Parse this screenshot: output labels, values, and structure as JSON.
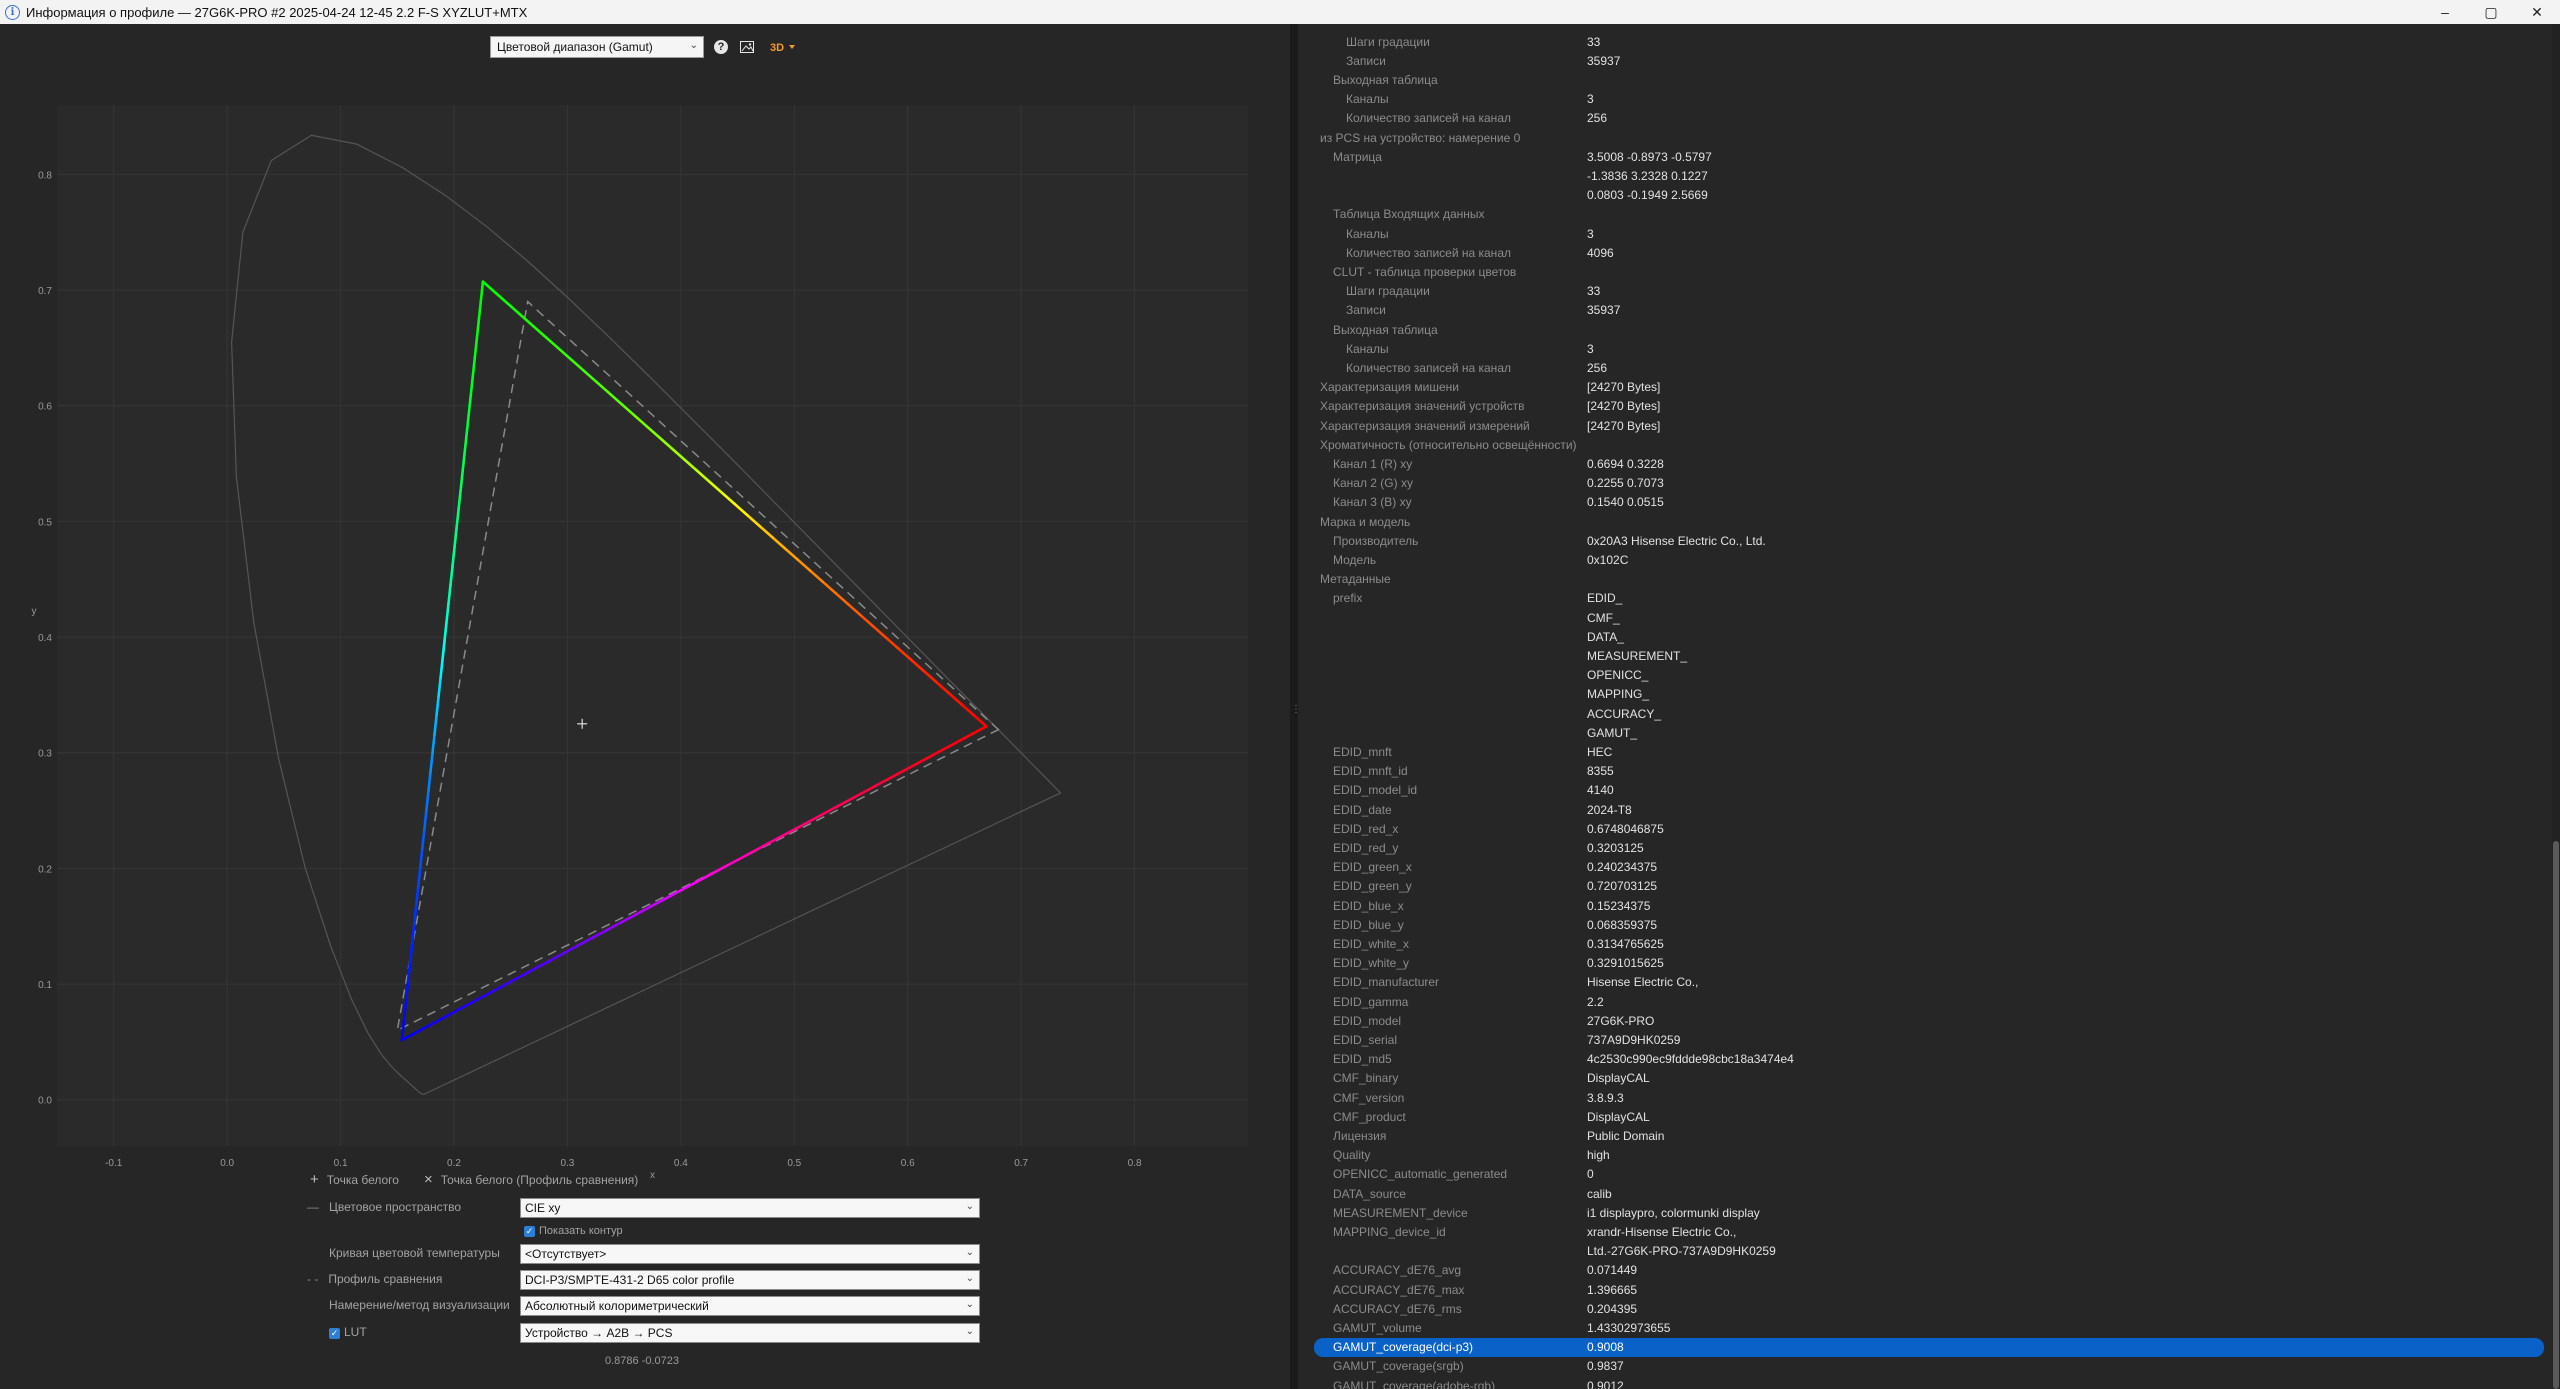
{
  "window": {
    "title": "Информация о профиле — 27G6K-PRO #2 2025-04-24 12-45 2.2 F-S XYZLUT+MTX",
    "minimize": "–",
    "maximize": "▢",
    "close": "✕"
  },
  "toolbar": {
    "view_mode": "Цветовой диапазон (Gamut)"
  },
  "chart_data": {
    "type": "scatter",
    "xlabel": "x",
    "ylabel": "y",
    "xlim": [
      -0.15,
      0.9
    ],
    "ylim": [
      -0.04,
      0.86
    ],
    "xticks": [
      "-0.1",
      "0.0",
      "0.1",
      "0.2",
      "0.3",
      "0.4",
      "0.5",
      "0.6",
      "0.7",
      "0.8"
    ],
    "yticks": [
      "0.0",
      "0.1",
      "0.2",
      "0.3",
      "0.4",
      "0.5",
      "0.6",
      "0.7",
      "0.8"
    ],
    "grid": true,
    "spectral_locus": [
      [
        0.1741,
        0.005
      ],
      [
        0.1738,
        0.0049
      ],
      [
        0.1736,
        0.0049
      ],
      [
        0.1733,
        0.0048
      ],
      [
        0.173,
        0.0048
      ],
      [
        0.1726,
        0.0048
      ],
      [
        0.1721,
        0.0048
      ],
      [
        0.1714,
        0.0051
      ],
      [
        0.1703,
        0.0058
      ],
      [
        0.1689,
        0.0069
      ],
      [
        0.1669,
        0.0086
      ],
      [
        0.1644,
        0.0109
      ],
      [
        0.1611,
        0.0138
      ],
      [
        0.1566,
        0.0177
      ],
      [
        0.151,
        0.0227
      ],
      [
        0.144,
        0.0297
      ],
      [
        0.1355,
        0.0399
      ],
      [
        0.1241,
        0.0578
      ],
      [
        0.1096,
        0.0868
      ],
      [
        0.0913,
        0.1327
      ],
      [
        0.0687,
        0.2007
      ],
      [
        0.0454,
        0.295
      ],
      [
        0.0235,
        0.4127
      ],
      [
        0.0082,
        0.5384
      ],
      [
        0.0039,
        0.6548
      ],
      [
        0.0139,
        0.7502
      ],
      [
        0.0389,
        0.812
      ],
      [
        0.0743,
        0.8338
      ],
      [
        0.1142,
        0.8262
      ],
      [
        0.1547,
        0.8059
      ],
      [
        0.1929,
        0.7816
      ],
      [
        0.2296,
        0.7543
      ],
      [
        0.2658,
        0.7243
      ],
      [
        0.3016,
        0.6923
      ],
      [
        0.3373,
        0.6589
      ],
      [
        0.3731,
        0.6245
      ],
      [
        0.4087,
        0.5896
      ],
      [
        0.4441,
        0.5547
      ],
      [
        0.4788,
        0.5202
      ],
      [
        0.5125,
        0.4866
      ],
      [
        0.5448,
        0.4544
      ],
      [
        0.5752,
        0.4242
      ],
      [
        0.6029,
        0.3965
      ],
      [
        0.627,
        0.3725
      ],
      [
        0.6482,
        0.3514
      ],
      [
        0.6658,
        0.334
      ],
      [
        0.6801,
        0.3197
      ],
      [
        0.6915,
        0.3083
      ],
      [
        0.7006,
        0.2993
      ],
      [
        0.7079,
        0.292
      ],
      [
        0.714,
        0.2859
      ],
      [
        0.719,
        0.2809
      ],
      [
        0.723,
        0.277
      ],
      [
        0.726,
        0.274
      ],
      [
        0.7283,
        0.2717
      ],
      [
        0.73,
        0.27
      ],
      [
        0.7311,
        0.2689
      ],
      [
        0.732,
        0.268
      ],
      [
        0.7327,
        0.2673
      ],
      [
        0.7334,
        0.2666
      ],
      [
        0.734,
        0.266
      ],
      [
        0.7344,
        0.2656
      ],
      [
        0.7346,
        0.2654
      ],
      [
        0.7347,
        0.2653
      ]
    ],
    "profile_gamut": {
      "red": [
        0.6694,
        0.3228
      ],
      "green": [
        0.2255,
        0.7073
      ],
      "blue": [
        0.154,
        0.0515
      ]
    },
    "reference_gamut": {
      "red": [
        0.68,
        0.32
      ],
      "green": [
        0.265,
        0.69
      ],
      "blue": [
        0.15,
        0.06
      ]
    },
    "cursor": [
      0.313,
      0.325
    ]
  },
  "controls": {
    "whitepoint": "Точка белого",
    "whitepoint_ref": "Точка белого (Профиль сравнения)",
    "colorspace_label": "Цветовое пространство",
    "colorspace_value": "CIE xy",
    "show_outline": "Показать контур",
    "cct_label": "Кривая цветовой температуры",
    "cct_value": "<Отсутствует>",
    "compare_label": "Профиль сравнения",
    "compare_value": "DCI-P3/SMPTE-431-2 D65 color profile",
    "intent_label": "Намерение/метод визуализации",
    "intent_value": "Абсолютный колориметрический",
    "lut_label": "LUT",
    "lut_value": "Устройство → A2B → PCS",
    "coords": "0.8786 -0.0723"
  },
  "tree": [
    {
      "k": "Шаги градации",
      "v": "33",
      "lvl": 3
    },
    {
      "k": "Записи",
      "v": "35937",
      "lvl": 3
    },
    {
      "k": "Выходная таблица",
      "v": "",
      "lvl": 2
    },
    {
      "k": "Каналы",
      "v": "3",
      "lvl": 3
    },
    {
      "k": "Количество записей на канал",
      "v": "256",
      "lvl": 3
    },
    {
      "k": "из PCS на устройство: намерение 0",
      "v": "",
      "lvl": 1
    },
    {
      "k": "Матрица",
      "v": "3.5008 -0.8973 -0.5797",
      "lvl": 2
    },
    {
      "k": "",
      "v": "-1.3836 3.2328 0.1227",
      "lvl": 2
    },
    {
      "k": "",
      "v": "0.0803 -0.1949 2.5669",
      "lvl": 2
    },
    {
      "k": "Таблица Входящих данных",
      "v": "",
      "lvl": 2
    },
    {
      "k": "Каналы",
      "v": "3",
      "lvl": 3
    },
    {
      "k": "Количество записей на канал",
      "v": "4096",
      "lvl": 3
    },
    {
      "k": "CLUT - таблица проверки цветов",
      "v": "",
      "lvl": 2
    },
    {
      "k": "Шаги градации",
      "v": "33",
      "lvl": 3
    },
    {
      "k": "Записи",
      "v": "35937",
      "lvl": 3
    },
    {
      "k": "Выходная таблица",
      "v": "",
      "lvl": 2
    },
    {
      "k": "Каналы",
      "v": "3",
      "lvl": 3
    },
    {
      "k": "Количество записей на канал",
      "v": "256",
      "lvl": 3
    },
    {
      "k": "Характеризация мишени",
      "v": "[24270 Bytes]",
      "lvl": 1
    },
    {
      "k": "Характеризация значений устройств",
      "v": "[24270 Bytes]",
      "lvl": 1
    },
    {
      "k": "Характеризация значений измерений",
      "v": "[24270 Bytes]",
      "lvl": 1
    },
    {
      "k": "Хроматичность (относительно освещённости)",
      "v": "",
      "lvl": 1
    },
    {
      "k": "Канал 1 (R) xy",
      "v": "0.6694 0.3228",
      "lvl": 2
    },
    {
      "k": "Канал 2 (G) xy",
      "v": "0.2255 0.7073",
      "lvl": 2
    },
    {
      "k": "Канал 3 (B) xy",
      "v": "0.1540 0.0515",
      "lvl": 2
    },
    {
      "k": "Марка и модель",
      "v": "",
      "lvl": 1
    },
    {
      "k": "Производитель",
      "v": "0x20A3 Hisense Electric Co., Ltd.",
      "lvl": 2
    },
    {
      "k": "Модель",
      "v": "0x102C",
      "lvl": 2
    },
    {
      "k": "Метаданные",
      "v": "",
      "lvl": 1
    },
    {
      "k": "prefix",
      "v": "EDID_",
      "lvl": 2
    },
    {
      "k": "",
      "v": "CMF_",
      "lvl": 2
    },
    {
      "k": "",
      "v": "DATA_",
      "lvl": 2
    },
    {
      "k": "",
      "v": "MEASUREMENT_",
      "lvl": 2
    },
    {
      "k": "",
      "v": "OPENICC_",
      "lvl": 2
    },
    {
      "k": "",
      "v": "MAPPING_",
      "lvl": 2
    },
    {
      "k": "",
      "v": "ACCURACY_",
      "lvl": 2
    },
    {
      "k": "",
      "v": "GAMUT_",
      "lvl": 2
    },
    {
      "k": "EDID_mnft",
      "v": "HEC",
      "lvl": 2
    },
    {
      "k": "EDID_mnft_id",
      "v": "8355",
      "lvl": 2
    },
    {
      "k": "EDID_model_id",
      "v": "4140",
      "lvl": 2
    },
    {
      "k": "EDID_date",
      "v": "2024-T8",
      "lvl": 2
    },
    {
      "k": "EDID_red_x",
      "v": "0.6748046875",
      "lvl": 2
    },
    {
      "k": "EDID_red_y",
      "v": "0.3203125",
      "lvl": 2
    },
    {
      "k": "EDID_green_x",
      "v": "0.240234375",
      "lvl": 2
    },
    {
      "k": "EDID_green_y",
      "v": "0.720703125",
      "lvl": 2
    },
    {
      "k": "EDID_blue_x",
      "v": "0.15234375",
      "lvl": 2
    },
    {
      "k": "EDID_blue_y",
      "v": "0.068359375",
      "lvl": 2
    },
    {
      "k": "EDID_white_x",
      "v": "0.3134765625",
      "lvl": 2
    },
    {
      "k": "EDID_white_y",
      "v": "0.3291015625",
      "lvl": 2
    },
    {
      "k": "EDID_manufacturer",
      "v": "Hisense Electric Co.,",
      "lvl": 2
    },
    {
      "k": "EDID_gamma",
      "v": "2.2",
      "lvl": 2
    },
    {
      "k": "EDID_model",
      "v": "27G6K-PRO",
      "lvl": 2
    },
    {
      "k": "EDID_serial",
      "v": "737A9D9HK0259",
      "lvl": 2
    },
    {
      "k": "EDID_md5",
      "v": "4c2530c990ec9fddde98cbc18a3474e4",
      "lvl": 2
    },
    {
      "k": "CMF_binary",
      "v": "DisplayCAL",
      "lvl": 2
    },
    {
      "k": "CMF_version",
      "v": "3.8.9.3",
      "lvl": 2
    },
    {
      "k": "CMF_product",
      "v": "DisplayCAL",
      "lvl": 2
    },
    {
      "k": "Лицензия",
      "v": "Public Domain",
      "lvl": 2
    },
    {
      "k": "Quality",
      "v": "high",
      "lvl": 2
    },
    {
      "k": "OPENICC_automatic_generated",
      "v": "0",
      "lvl": 2
    },
    {
      "k": "DATA_source",
      "v": "calib",
      "lvl": 2
    },
    {
      "k": "MEASUREMENT_device",
      "v": "i1 displaypro, colormunki display",
      "lvl": 2
    },
    {
      "k": "MAPPING_device_id",
      "v": "xrandr-Hisense Electric Co.,",
      "lvl": 2
    },
    {
      "k": "",
      "v": "Ltd.-27G6K-PRO-737A9D9HK0259",
      "lvl": 2
    },
    {
      "k": "ACCURACY_dE76_avg",
      "v": "0.071449",
      "lvl": 2
    },
    {
      "k": "ACCURACY_dE76_max",
      "v": "1.396665",
      "lvl": 2
    },
    {
      "k": "ACCURACY_dE76_rms",
      "v": "0.204395",
      "lvl": 2
    },
    {
      "k": "GAMUT_volume",
      "v": "1.43302973655",
      "lvl": 2
    },
    {
      "k": "GAMUT_coverage(dci-p3)",
      "v": "0.9008",
      "lvl": 2,
      "selected": true
    },
    {
      "k": "GAMUT_coverage(srgb)",
      "v": "0.9837",
      "lvl": 2
    },
    {
      "k": "GAMUT_coverage(adobe-rgb)",
      "v": "0.9012",
      "lvl": 2
    }
  ]
}
